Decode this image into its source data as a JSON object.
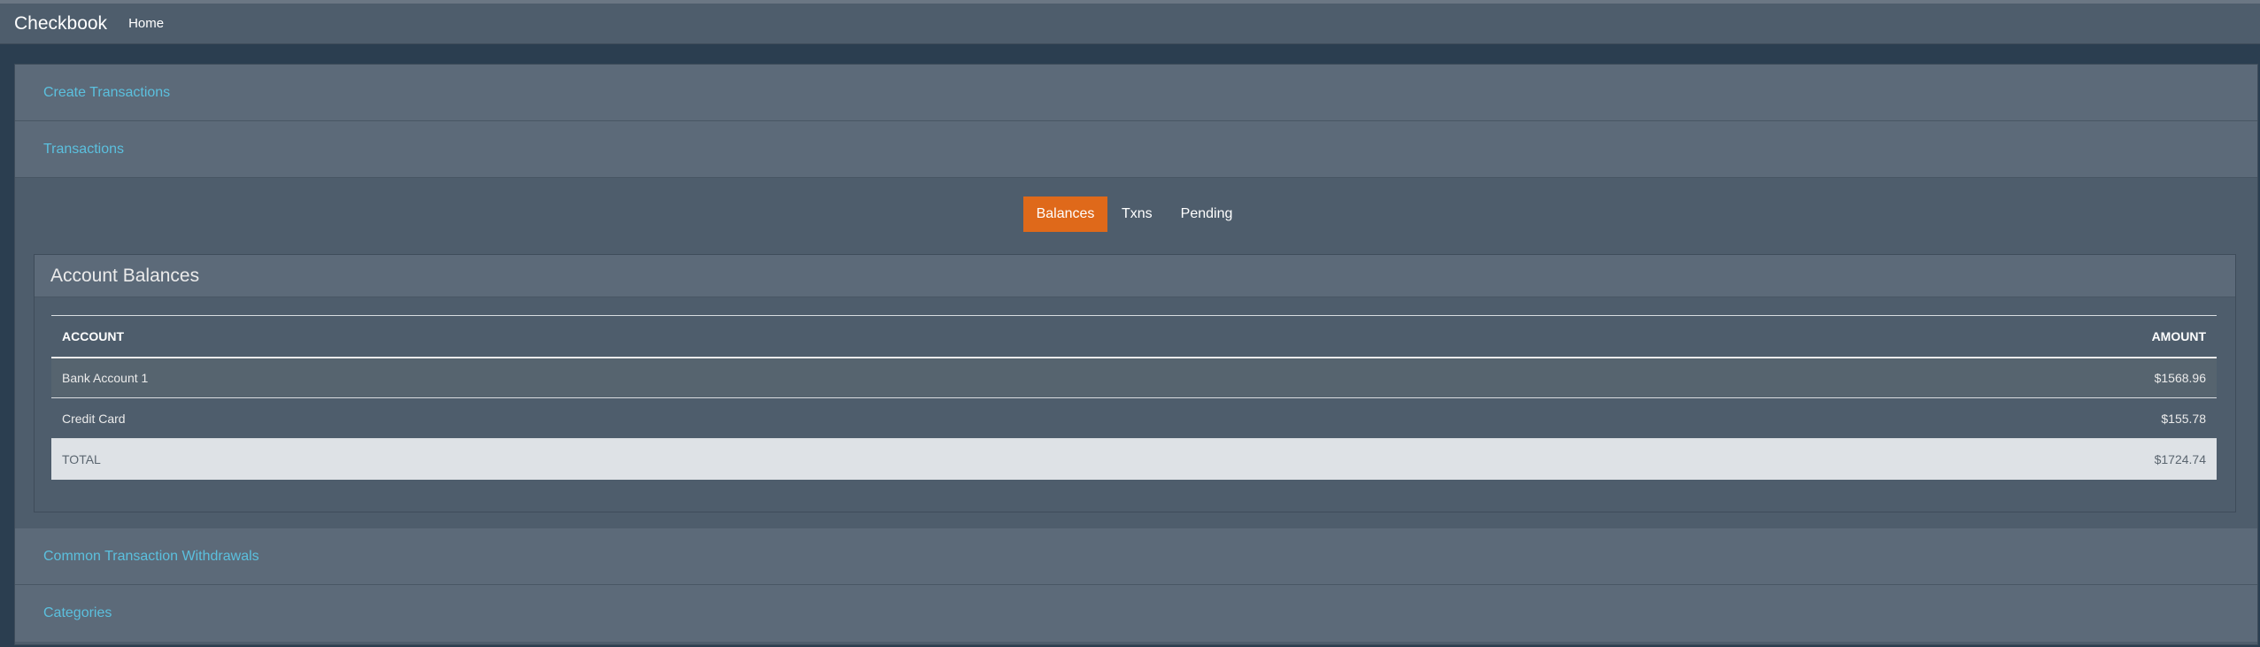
{
  "navbar": {
    "brand": "Checkbook",
    "links": [
      "Home"
    ]
  },
  "sections": {
    "create": "Create Transactions",
    "transactions": "Transactions",
    "withdrawals": "Common Transaction Withdrawals",
    "categories": "Categories"
  },
  "tabs": {
    "balances": "Balances",
    "txns": "Txns",
    "pending": "Pending",
    "active": "Balances"
  },
  "balances": {
    "title": "Account Balances",
    "columns": {
      "account": "ACCOUNT",
      "amount": "AMOUNT"
    },
    "rows": [
      {
        "account": "Bank Account 1",
        "amount": "$1568.96"
      },
      {
        "account": "Credit Card",
        "amount": "$155.78"
      }
    ],
    "total": {
      "label": "TOTAL",
      "amount": "$1724.74"
    }
  },
  "colors": {
    "accent": "#df691a",
    "link": "#5bc0de",
    "background": "#2b3e50",
    "panel": "#4e5d6c"
  }
}
